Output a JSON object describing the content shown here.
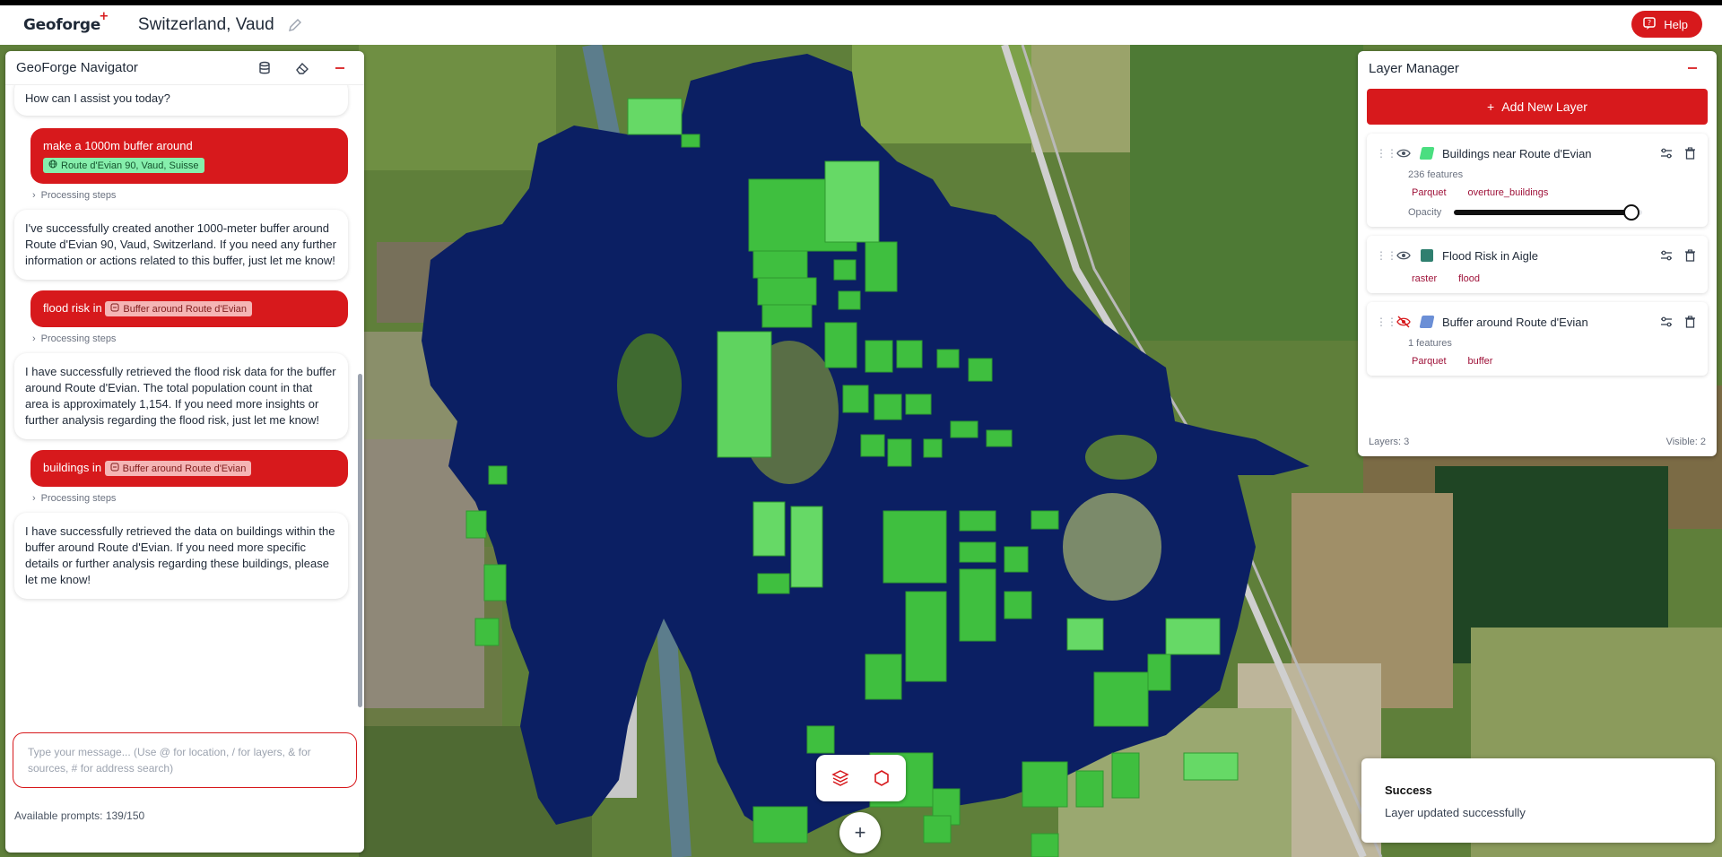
{
  "header": {
    "logo": "Geoforge",
    "logo_mark": "+",
    "project_title": "Switzerland, Vaud",
    "help_label": "Help"
  },
  "navigator": {
    "title": "GeoForge Navigator",
    "messages": [
      {
        "role": "assistant",
        "text": "How can I assist you today?"
      },
      {
        "role": "user",
        "text": "make a 1000m buffer around",
        "tag": "Route d'Evian 90, Vaud, Suisse"
      },
      {
        "role": "steps",
        "text": "Processing steps"
      },
      {
        "role": "assistant",
        "text": "I've successfully created another 1000-meter buffer around Route d'Evian 90, Vaud, Switzerland. If you need any further information or actions related to this buffer, just let me know!"
      },
      {
        "role": "user",
        "text": "flood risk in",
        "tag": "Buffer around Route d'Evian"
      },
      {
        "role": "steps",
        "text": "Processing steps"
      },
      {
        "role": "assistant",
        "text": "I have successfully retrieved the flood risk data for the buffer around Route d'Evian. The total population count in that area is approximately 1,154. If you need more insights or further analysis regarding the flood risk, just let me know!"
      },
      {
        "role": "user",
        "text": "buildings in",
        "tag": "Buffer around Route d'Evian"
      },
      {
        "role": "steps",
        "text": "Processing steps"
      },
      {
        "role": "assistant",
        "text": "I have successfully retrieved the data on buildings within the buffer around Route d'Evian. If you need more specific details or further analysis regarding these buildings, please let me know!"
      }
    ],
    "input_placeholder": "Type your message... (Use @ for location, / for layers, & for sources, # for address search)",
    "prompts_label": "Available prompts: 139/150"
  },
  "layer_manager": {
    "title": "Layer Manager",
    "add_label": "Add New Layer",
    "layers": [
      {
        "name": "Buildings near Route d'Evian",
        "features": "236 features",
        "chips": [
          "Parquet",
          "overture_buildings"
        ],
        "visible": true,
        "color": "#4ade80",
        "opacity_label": "Opacity",
        "opacity": 0.94
      },
      {
        "name": "Flood Risk in Aigle",
        "chips": [
          "raster",
          "flood"
        ],
        "visible": true,
        "color": "#2f7f6f"
      },
      {
        "name": "Buffer around Route d'Evian",
        "features": "1 features",
        "chips": [
          "Parquet",
          "buffer"
        ],
        "visible": false,
        "color": "#6b8fd6"
      }
    ],
    "footer_layers": "Layers: 3",
    "footer_visible": "Visible: 2"
  },
  "toast": {
    "title": "Success",
    "message": "Layer updated successfully"
  },
  "colors": {
    "accent": "#d7191c",
    "flood": "#0b1f63",
    "buildings": "#4ade80"
  }
}
